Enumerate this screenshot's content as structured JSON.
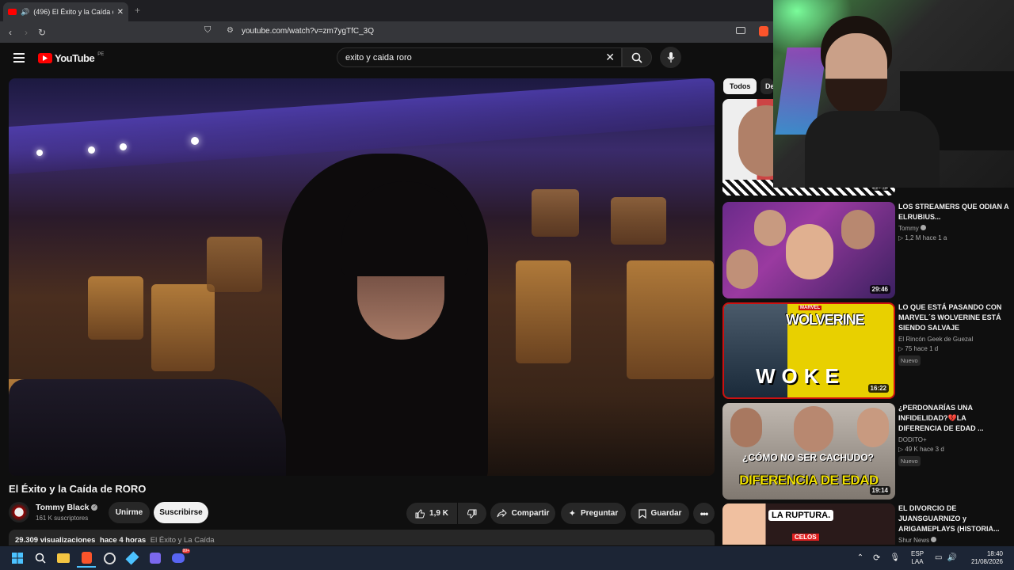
{
  "browser": {
    "tab_title": "(496) El Éxito y la Caída de R...",
    "url": "youtube.com/watch?v=zm7ygTfC_3Q"
  },
  "youtube": {
    "logo": "YouTube",
    "region": "PE",
    "search_value": "exito y caida roro"
  },
  "video": {
    "title": "El Éxito y la Caída de RORO",
    "channel": "Tommy Black",
    "subscribers": "161 K suscriptores",
    "join_label": "Unirme",
    "subscribe_label": "Suscribirse",
    "likes": "1,9 K",
    "share_label": "Compartir",
    "ask_label": "Preguntar",
    "save_label": "Guardar",
    "views": "29.309 visualizaciones",
    "age": "hace 4 horas",
    "tags": "El Éxito y La Caída"
  },
  "sidebar": {
    "chips": [
      "Todos",
      "De"
    ],
    "top_duration": "38:42",
    "items": [
      {
        "title": "LOS STREAMERS QUE ODIAN A ELRUBIUS...",
        "channel": "Tommy",
        "views": "1,2 M",
        "age": "hace 1 a",
        "duration": "29:46",
        "badge": ""
      },
      {
        "title": "LO QUE ESTÁ PASANDO CON MARVEL´S WOLVERINE ESTÁ SIENDO SALVAJE",
        "channel": "El Rincón Geek de Guezal",
        "views": "75",
        "age": "hace 1 d",
        "duration": "16:22",
        "badge": "Nuevo"
      },
      {
        "title": "¿PERDONARÍAS UNA INFIDELIDAD?💔LA DIFERENCIA DE EDAD ...",
        "channel": "DODITO+",
        "views": "49 K",
        "age": "hace 3 d",
        "duration": "19:14",
        "badge": "Nuevo"
      },
      {
        "title": "EL DIVORCIO DE JUANSGUARNIZO y ARIGAMEPLAYS (HISTORIA...",
        "channel": "Shur News",
        "views": "",
        "age": "",
        "duration": "",
        "badge": ""
      }
    ],
    "thumb_text": {
      "wolverine": "WOLVERINE",
      "woke": "WOKE",
      "marvel": "MARVEL",
      "edad_top": "¿CÓMO NO SER CACHUDO?",
      "edad_bottom": "DIFERENCIA DE EDAD",
      "ruptura": "LA RUPTURA.",
      "celos": "CELOS"
    }
  },
  "taskbar": {
    "lang1": "ESP",
    "lang2": "LAA",
    "time": "18:40",
    "date": "21/08/2026",
    "discord_badge": "99+"
  },
  "colors": {
    "bg": "#0f0f0f",
    "yt_red": "#ff0000",
    "subscribe_bg": "#f1f1f1"
  }
}
